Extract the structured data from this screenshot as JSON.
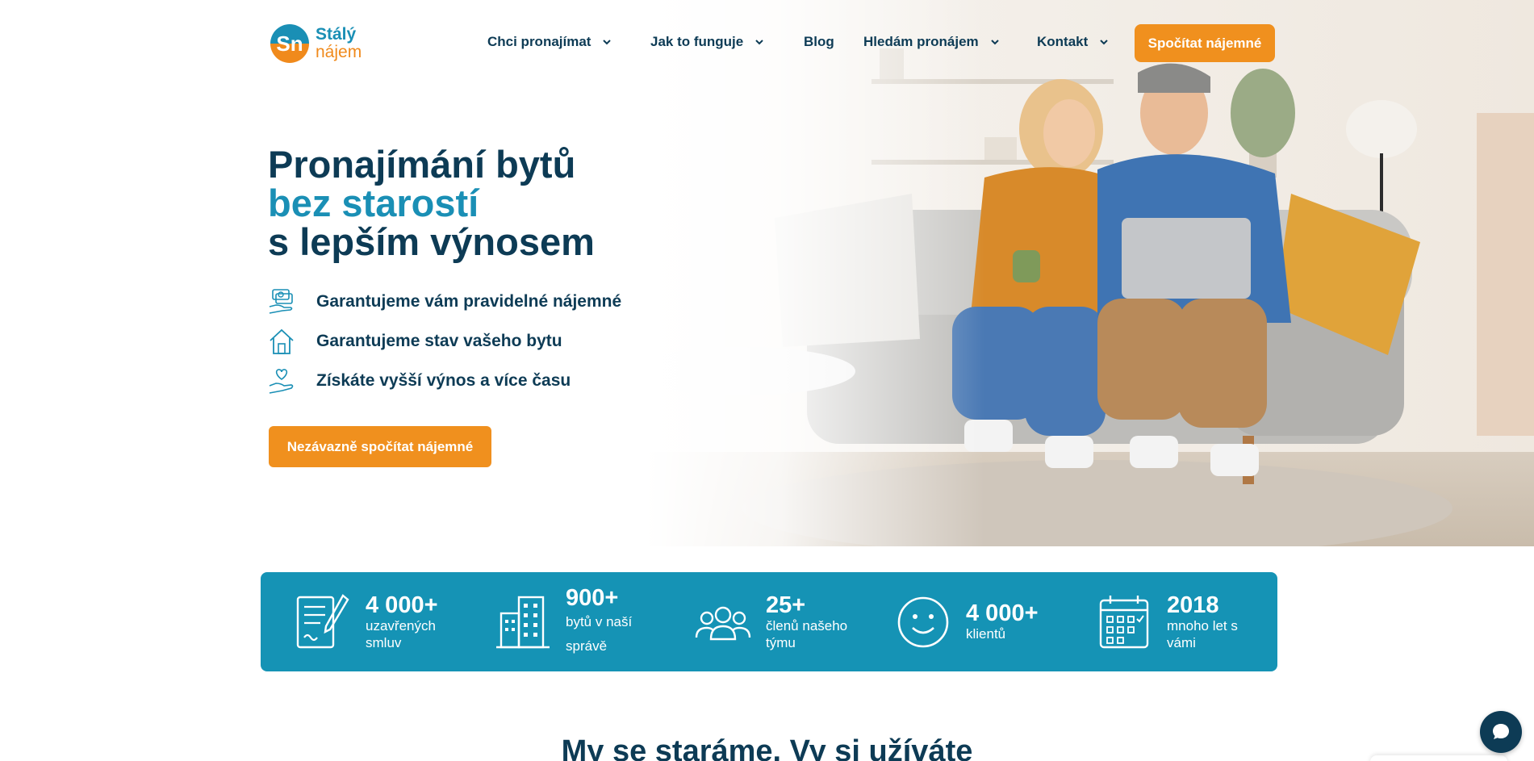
{
  "brand": {
    "logo_monogram": "Sn",
    "name_line1": "Stálý",
    "name_line2": "nájem",
    "colors": {
      "primary": "#0d3b55",
      "accent": "#1a8fb5",
      "orange": "#f0901e",
      "stats_bg": "#1593b5"
    }
  },
  "nav": {
    "items": [
      {
        "label": "Chci pronajímat",
        "icon": "chevron-down-icon"
      },
      {
        "label": "Jak to funguje",
        "icon": "chevron-down-icon"
      },
      {
        "label": "Blog"
      },
      {
        "label": "Hledám pronájem",
        "icon": "chevron-down-icon"
      },
      {
        "label": "Kontakt",
        "icon": "chevron-down-icon"
      }
    ],
    "cta_label": "Spočítat nájemné"
  },
  "hero": {
    "title_line1": "Pronajímání bytů",
    "title_line2": "bez starostí",
    "title_line3": "s lepším výnosem",
    "features": [
      {
        "icon": "money-hand-icon",
        "text": "Garantujeme vám pravidelné nájemné"
      },
      {
        "icon": "house-icon",
        "text": "Garantujeme stav vašeho bytu"
      },
      {
        "icon": "heart-hand-icon",
        "text": "Získáte vyšší výnos a více času"
      }
    ],
    "cta_label": "Nezávazně spočítat nájemné"
  },
  "stats": [
    {
      "icon": "contract-pen-icon",
      "number": "4 000+",
      "label": "uzavřených smluv"
    },
    {
      "icon": "buildings-icon",
      "number": "900+",
      "label": "bytů v naší správě"
    },
    {
      "icon": "team-icon",
      "number": "25+",
      "label": "členů našeho týmu"
    },
    {
      "icon": "smiley-icon",
      "number": "4 000+",
      "label": "klientů"
    },
    {
      "icon": "calendar-icon",
      "number": "2018",
      "label": "mnoho let s vámi"
    }
  ],
  "section": {
    "title": "My se staráme. Vy si užíváte"
  },
  "chat": {
    "icon": "chat-bubble-icon"
  }
}
